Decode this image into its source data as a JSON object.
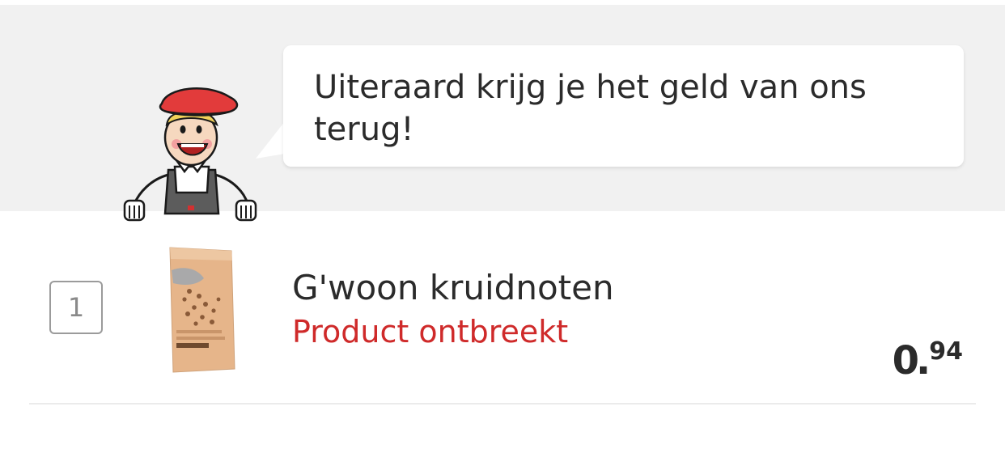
{
  "banner": {
    "message": "Uiteraard krijg je het geld van ons terug!"
  },
  "item": {
    "quantity": "1",
    "name": "G'woon kruidnoten",
    "status": "Product ontbreekt",
    "price_integer": "0",
    "price_decimals": "94",
    "status_color": "#cf2a2a"
  }
}
